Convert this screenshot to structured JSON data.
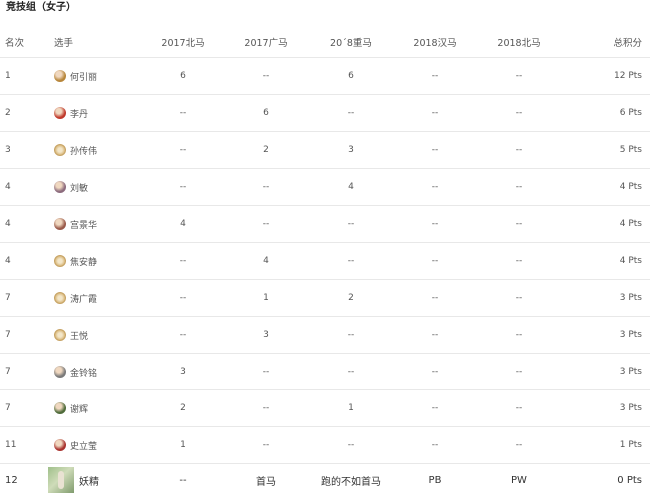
{
  "heading": "竞技组（女子）",
  "columns": {
    "rank": "名次",
    "player": "选手",
    "beijing_2017": "2017北马",
    "guangzhou_2017": "2017广马",
    "chongqing_2018": "20´8重马",
    "hanzhou_2018": "2018汉马",
    "beijing_2018": "2018北马",
    "total": "总积分"
  },
  "rows": [
    {
      "rank": "1",
      "name": "何引丽",
      "avatar": "photo-avatar",
      "avatar_color": "#b7863a",
      "b17": "6",
      "g17": "--",
      "c18": "6",
      "h18": "--",
      "b18": "--",
      "total": "12 Pts"
    },
    {
      "rank": "2",
      "name": "李丹",
      "avatar": "photo-avatar",
      "avatar_color": "#c0392b",
      "b17": "--",
      "g17": "6",
      "c18": "--",
      "h18": "--",
      "b18": "--",
      "total": "6 Pts"
    },
    {
      "rank": "3",
      "name": "孙传伟",
      "avatar": "medal-avatar",
      "avatar_color": "#d8b77a",
      "b17": "--",
      "g17": "2",
      "c18": "3",
      "h18": "--",
      "b18": "--",
      "total": "5 Pts"
    },
    {
      "rank": "4",
      "name": "刘敏",
      "avatar": "photo-avatar",
      "avatar_color": "#8c6b7d",
      "b17": "--",
      "g17": "--",
      "c18": "4",
      "h18": "--",
      "b18": "--",
      "total": "4 Pts"
    },
    {
      "rank": "4",
      "name": "宫景华",
      "avatar": "photo-avatar",
      "avatar_color": "#9a5a4a",
      "b17": "4",
      "g17": "--",
      "c18": "--",
      "h18": "--",
      "b18": "--",
      "total": "4 Pts"
    },
    {
      "rank": "4",
      "name": "焦安静",
      "avatar": "medal-avatar",
      "avatar_color": "#d8b77a",
      "b17": "--",
      "g17": "4",
      "c18": "--",
      "h18": "--",
      "b18": "--",
      "total": "4 Pts"
    },
    {
      "rank": "7",
      "name": "涛广霞",
      "avatar": "medal-avatar",
      "avatar_color": "#d8b77a",
      "b17": "--",
      "g17": "1",
      "c18": "2",
      "h18": "--",
      "b18": "--",
      "total": "3 Pts"
    },
    {
      "rank": "7",
      "name": "王悦",
      "avatar": "medal-avatar",
      "avatar_color": "#d8b77a",
      "b17": "--",
      "g17": "3",
      "c18": "--",
      "h18": "--",
      "b18": "--",
      "total": "3 Pts"
    },
    {
      "rank": "7",
      "name": "金铃铭",
      "avatar": "photo-avatar",
      "avatar_color": "#7a7a7a",
      "b17": "3",
      "g17": "--",
      "c18": "--",
      "h18": "--",
      "b18": "--",
      "total": "3 Pts"
    },
    {
      "rank": "7",
      "name": "谢辉",
      "avatar": "photo-avatar",
      "avatar_color": "#4f6b3a",
      "b17": "2",
      "g17": "--",
      "c18": "1",
      "h18": "--",
      "b18": "--",
      "total": "3 Pts"
    },
    {
      "rank": "11",
      "name": "史立莹",
      "avatar": "photo-avatar",
      "avatar_color": "#a8322e",
      "b17": "1",
      "g17": "--",
      "c18": "--",
      "h18": "--",
      "b18": "--",
      "total": "1 Pts"
    },
    {
      "rank": "12",
      "name": "妖精",
      "avatar": "large-photo-avatar",
      "avatar_color": "#9fbf8a",
      "b17": "--",
      "g17": "首马",
      "c18": "跑的不如首马",
      "h18": "PB",
      "b18": "PW",
      "total": "0 Pts"
    }
  ]
}
